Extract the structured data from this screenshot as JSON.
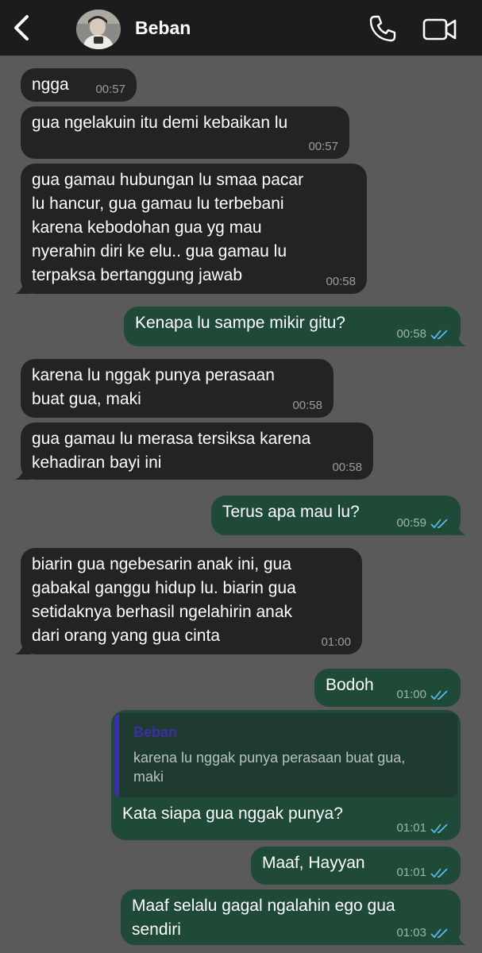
{
  "header": {
    "contact_name": "Beban",
    "back_icon": "chevron-left-icon",
    "call_icon": "phone-icon",
    "video_icon": "video-camera-icon"
  },
  "messages": [
    {
      "dir": "in",
      "text": "ngga",
      "time": "00:57"
    },
    {
      "dir": "in",
      "text": "gua ngelakuin itu demi kebaikan lu",
      "time": "00:57"
    },
    {
      "dir": "in",
      "text": "gua gamau hubungan lu smaa pacar\nlu hancur, gua gamau lu terbebani\nkarena kebodohan gua yg mau\nnyerahin diri ke elu.. gua gamau lu\nterpaksa bertanggung jawab",
      "time": "00:58"
    },
    {
      "dir": "out",
      "text": "Kenapa lu sampe mikir gitu?",
      "time": "00:58",
      "status": "read"
    },
    {
      "dir": "in",
      "text": "karena lu nggak punya perasaan\nbuat gua, maki",
      "time": "00:58"
    },
    {
      "dir": "in",
      "text": "gua gamau lu merasa tersiksa karena\nkehadiran bayi ini",
      "time": "00:58"
    },
    {
      "dir": "out",
      "text": "Terus apa mau lu?",
      "time": "00:59",
      "status": "read"
    },
    {
      "dir": "in",
      "text": "biarin gua ngebesarin anak ini, gua\ngabakal ganggu hidup lu. biarin gua\nsetidaknya berhasil ngelahirin anak\ndari orang yang gua cinta",
      "time": "01:00"
    },
    {
      "dir": "out",
      "text": "Bodoh",
      "time": "01:00",
      "status": "read"
    },
    {
      "dir": "out",
      "text": "Kata siapa gua nggak punya?",
      "time": "01:01",
      "status": "read",
      "quote": {
        "name": "Beban",
        "text": "karena lu nggak punya perasaan buat gua,\nmaki"
      }
    },
    {
      "dir": "out",
      "text": "Maaf, Hayyan",
      "time": "01:01",
      "status": "read"
    },
    {
      "dir": "out",
      "text": "Maaf selalu gagal ngalahin ego gua\nsendiri",
      "time": "01:03",
      "status": "read"
    }
  ],
  "colors": {
    "background": "#5a5a5a",
    "header": "#1c1c1e",
    "incoming_bubble": "#232323",
    "outgoing_bubble": "#1f4a37",
    "read_ticks": "#53bdeb",
    "quote_accent": "#3b2fa8"
  }
}
